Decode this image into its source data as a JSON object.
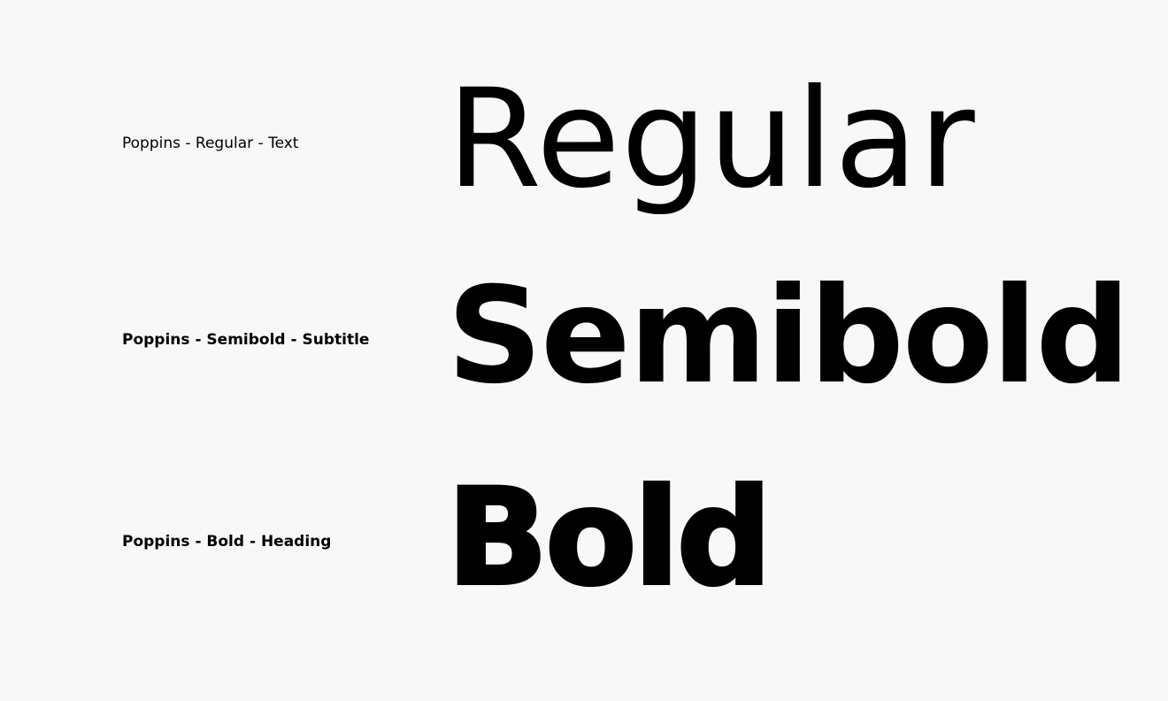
{
  "specimens": {
    "regular": {
      "label": "Poppins - Regular - Text",
      "sample": "Regular"
    },
    "semibold": {
      "label": "Poppins - Semibold - Subtitle",
      "sample": "Semibold"
    },
    "bold": {
      "label": "Poppins - Bold - Heading",
      "sample": "Bold"
    }
  },
  "colors": {
    "background": "#f8f8f8",
    "text": "#000000"
  }
}
